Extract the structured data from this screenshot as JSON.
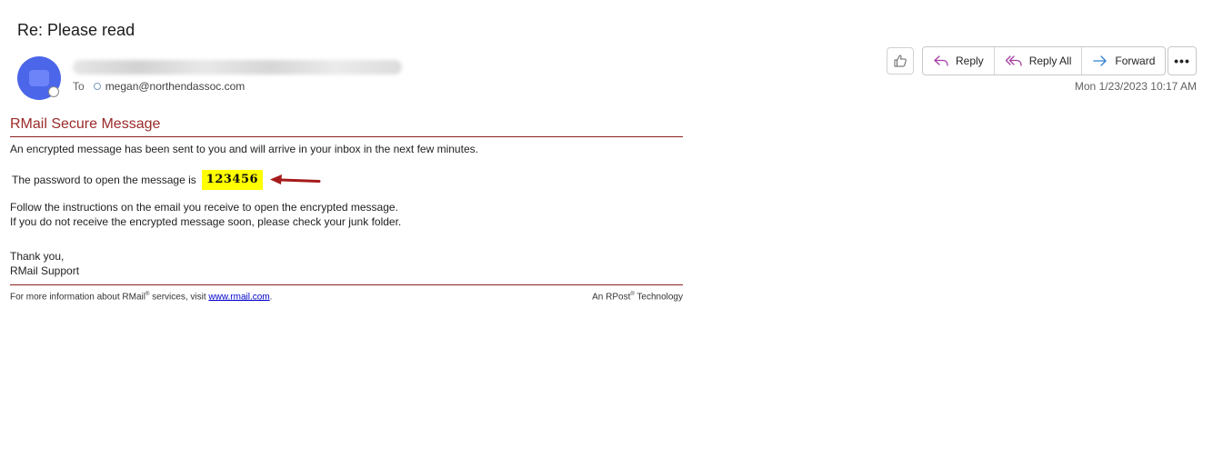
{
  "email": {
    "subject": "Re: Please read",
    "to_label": "To",
    "to_address": "megan@northendassoc.com",
    "date": "Mon 1/23/2023 10:17 AM"
  },
  "actions": {
    "reply": "Reply",
    "reply_all": "Reply All",
    "forward": "Forward",
    "more": "•••"
  },
  "message": {
    "title": "RMail Secure Message",
    "line1": "An encrypted message has been sent to you and will arrive in your inbox in the next few minutes.",
    "password_prefix": "The password to open the message is",
    "password": "123456",
    "line3a": "Follow the instructions on the email you receive to open the encrypted message.",
    "line3b": "If you do not receive the encrypted message soon, please check your junk folder.",
    "signoff1": "Thank you,",
    "signoff2": "RMail Support",
    "footer_left_a": "For more information about RMail",
    "footer_left_b": " services, visit ",
    "footer_link": "www.rmail.com",
    "footer_left_end": ".",
    "footer_right_a": "An RPost",
    "footer_right_b": " Technology",
    "reg": "®"
  },
  "colors": {
    "accent_red": "#9b2a2a",
    "avatar_blue": "#4b66e8",
    "highlight": "#ffff00"
  }
}
